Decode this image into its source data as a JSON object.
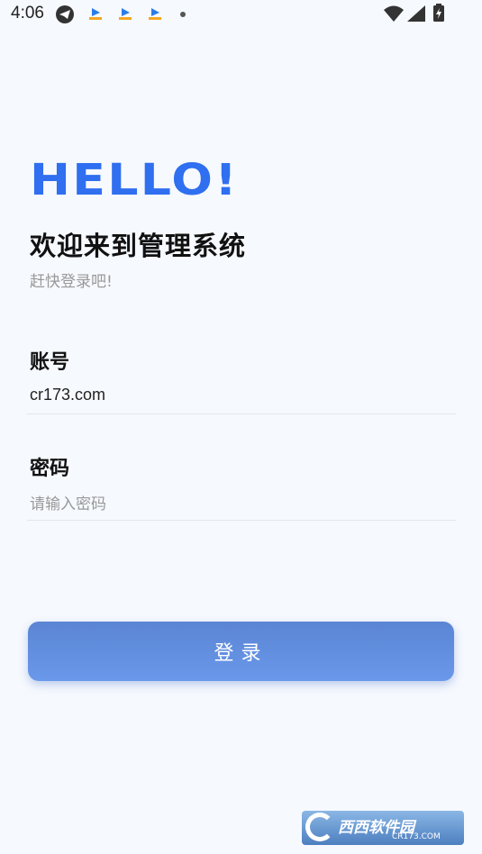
{
  "status_bar": {
    "time": "4:06",
    "icons": [
      "telegram-icon",
      "app-notification-icon",
      "app-notification-icon",
      "app-notification-icon",
      "more-dot-icon",
      "wifi-icon",
      "signal-icon",
      "battery-charging-icon"
    ]
  },
  "hero": {
    "hello": "HELLO!",
    "title": "欢迎来到管理系统",
    "subtitle": "赶快登录吧!"
  },
  "account": {
    "label": "账号",
    "value": "cr173.com"
  },
  "password": {
    "label": "密码",
    "placeholder": "请输入密码"
  },
  "login_button": {
    "label": "登录"
  },
  "watermark": {
    "text": "西西软件园",
    "sub": "CR173.COM"
  },
  "colors": {
    "accent": "#2f6ff0",
    "button": "#6a98ea",
    "background": "#f6f9fe"
  }
}
